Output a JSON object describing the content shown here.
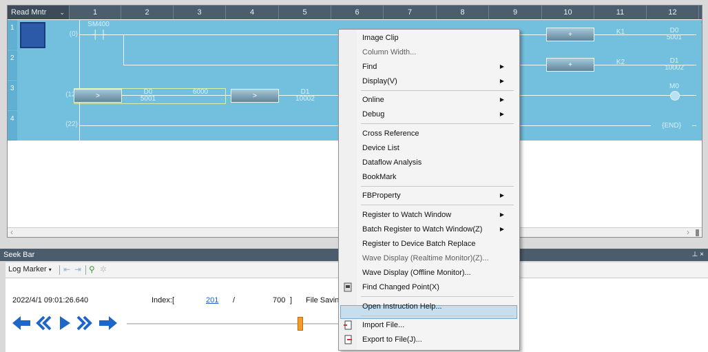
{
  "ladder": {
    "read_mode": "Read Mntr",
    "columns": [
      "1",
      "2",
      "3",
      "4",
      "5",
      "6",
      "7",
      "8",
      "9",
      "10",
      "11",
      "12"
    ],
    "rows": [
      {
        "num": "1",
        "step": "(0)"
      },
      {
        "num": "2",
        "step": ""
      },
      {
        "num": "3",
        "step": "(12)"
      },
      {
        "num": "4",
        "step": "(22)"
      }
    ],
    "contact_label": "SM400",
    "compare1": {
      "op": ">",
      "dev": "D0",
      "val": "5001",
      "k": "6000"
    },
    "compare2": {
      "op": ">",
      "dev": "D1",
      "val": "10002"
    },
    "add1": {
      "op": "+",
      "k": "K1",
      "dev": "D0",
      "val": "5001"
    },
    "add2": {
      "op": "+",
      "k": "K2",
      "dev": "D1",
      "val": "10002"
    },
    "coil": "M0",
    "end_label": "END"
  },
  "seek_bar": {
    "title": "Seek Bar",
    "log_marker": "Log Marker",
    "timestamp": "2022/4/1 09:01:26.640",
    "index_label": "Index:[",
    "index_value": "201",
    "index_slash": "/",
    "index_total": "700",
    "index_close": "]",
    "file_saving": "File Savin",
    "position_fraction": 0.286
  },
  "context_menu": {
    "items": [
      {
        "label": "Image Clip",
        "disabled": false,
        "submenu": false
      },
      {
        "label": "Column Width...",
        "disabled": true,
        "submenu": false
      },
      {
        "label": "Find",
        "disabled": false,
        "submenu": true
      },
      {
        "label": "Display(V)",
        "disabled": false,
        "submenu": true
      },
      {
        "label": "Online",
        "disabled": false,
        "submenu": true
      },
      {
        "label": "Debug",
        "disabled": false,
        "submenu": true
      },
      {
        "label": "Cross Reference",
        "disabled": false,
        "submenu": false
      },
      {
        "label": "Device List",
        "disabled": false,
        "submenu": false
      },
      {
        "label": "Dataflow Analysis",
        "disabled": false,
        "submenu": false
      },
      {
        "label": "BookMark",
        "disabled": false,
        "submenu": false
      },
      {
        "label": "FBProperty",
        "disabled": false,
        "submenu": true
      },
      {
        "label": "Register to Watch Window",
        "disabled": false,
        "submenu": true
      },
      {
        "label": "Batch Register to Watch Window(Z)",
        "disabled": false,
        "submenu": true
      },
      {
        "label": "Register to Device Batch Replace",
        "disabled": false,
        "submenu": false
      },
      {
        "label": "Wave Display (Realtime Monitor)(Z)...",
        "disabled": true,
        "submenu": false
      },
      {
        "label": "Wave Display (Offline Monitor)...",
        "disabled": false,
        "submenu": false,
        "highlighted": true
      },
      {
        "label": "Find Changed Point(X)",
        "disabled": false,
        "submenu": false
      },
      {
        "label": "Open Instruction Help...",
        "disabled": false,
        "submenu": false
      },
      {
        "label": "Import File...",
        "disabled": false,
        "submenu": false
      },
      {
        "label": "Export to File(J)...",
        "disabled": false,
        "submenu": false
      }
    ]
  },
  "colors": {
    "ladder_bg": "#73bfde",
    "header_bg": "#4c5d6d",
    "highlight": "#c5def0",
    "thumb": "#f59b26",
    "nav_blue": "#1f66c9"
  }
}
